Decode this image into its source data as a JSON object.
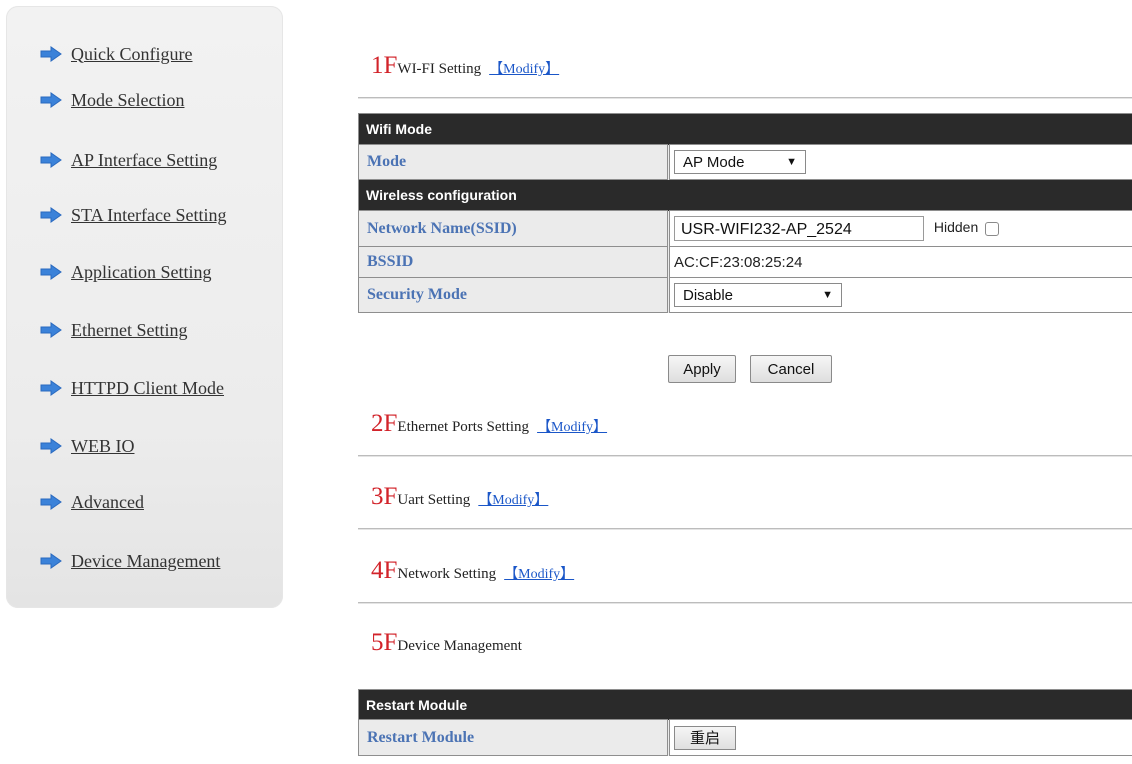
{
  "sidebar": {
    "items": [
      {
        "label": "Quick Configure"
      },
      {
        "label": "Mode Selection"
      },
      {
        "label": "AP Interface Setting"
      },
      {
        "label": "STA Interface Setting"
      },
      {
        "label": "Application Setting"
      },
      {
        "label": "Ethernet Setting"
      },
      {
        "label": "HTTPD Client Mode"
      },
      {
        "label": "WEB IO"
      },
      {
        "label": "Advanced"
      },
      {
        "label": "Device Management"
      }
    ],
    "arrow_color": "#3b82d9"
  },
  "sections": {
    "s1": {
      "floor": "1F",
      "title": " WI-FI Setting",
      "modify": "【Modify】"
    },
    "s2": {
      "floor": "2F",
      "title": "Ethernet Ports Setting",
      "modify": "【Modify】"
    },
    "s3": {
      "floor": "3F",
      "title": "Uart Setting",
      "modify": "【Modify】"
    },
    "s4": {
      "floor": "4F",
      "title": " Network Setting",
      "modify": "【Modify】"
    },
    "s5": {
      "floor": "5F",
      "title": " Device Management"
    }
  },
  "wifi": {
    "mode_header": "Wifi Mode",
    "mode_label": "Mode",
    "mode_value": "AP Mode",
    "wireless_header": "Wireless configuration",
    "ssid_label": "Network Name(SSID)",
    "ssid_value": "USR-WIFI232-AP_2524",
    "hidden_label": "Hidden",
    "bssid_label": "BSSID",
    "bssid_value": "AC:CF:23:08:25:24",
    "security_label": "Security Mode",
    "security_value": "Disable",
    "apply": "Apply",
    "cancel": "Cancel"
  },
  "device": {
    "header": "Restart Module",
    "restart_label": "Restart Module",
    "restart_button": "重启"
  },
  "colors": {
    "floor_red": "#d2232a",
    "label_blue": "#4b73b4",
    "header_bg": "#2a2a2a",
    "link_blue": "#1a56c8"
  }
}
